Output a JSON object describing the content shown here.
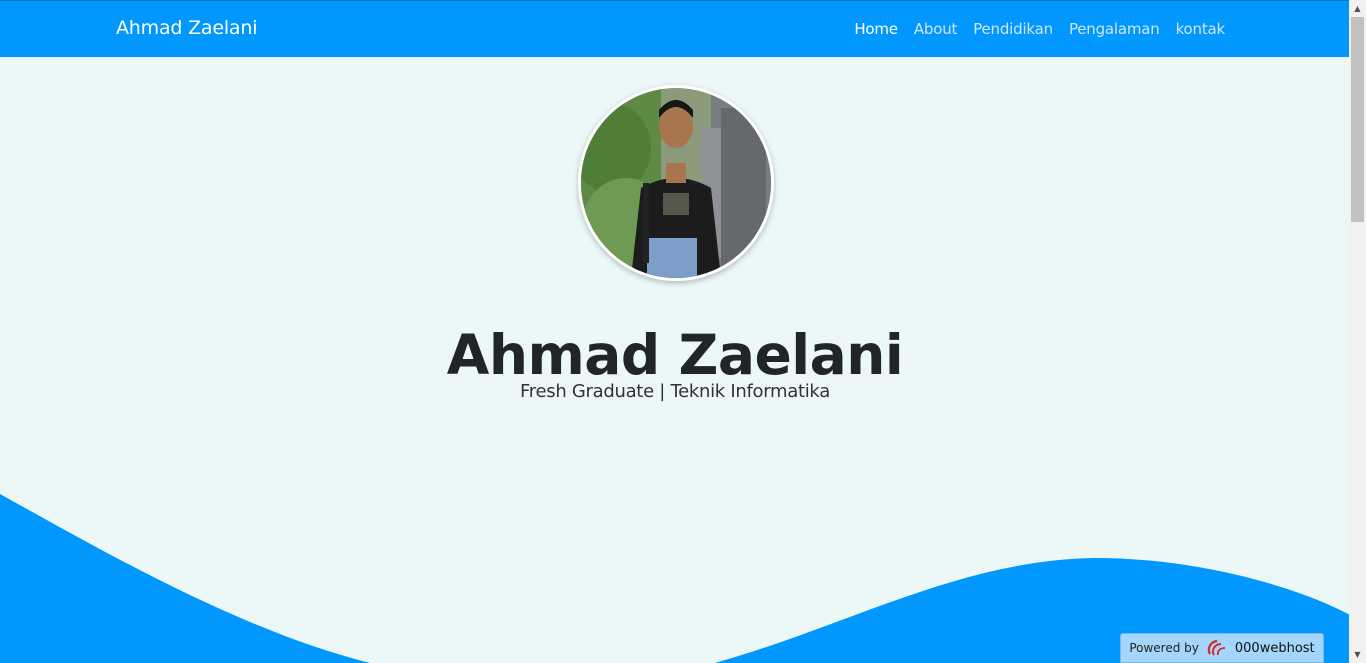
{
  "navbar": {
    "brand": "Ahmad Zaelani",
    "items": [
      {
        "label": "Home",
        "active": true
      },
      {
        "label": "About",
        "active": false
      },
      {
        "label": "Pendidikan",
        "active": false
      },
      {
        "label": "Pengalaman",
        "active": false
      },
      {
        "label": "kontak",
        "active": false
      }
    ]
  },
  "hero": {
    "name": "Ahmad Zaelani",
    "tagline": "Fresh Graduate | Teknik Informatika",
    "avatar_icon": "profile-photo"
  },
  "badge": {
    "prefix": "Powered by",
    "brand": "000webhost",
    "icon": "000webhost-logo"
  },
  "colors": {
    "primary": "#0097ff",
    "background": "#ecf7f8",
    "text": "#212529"
  }
}
